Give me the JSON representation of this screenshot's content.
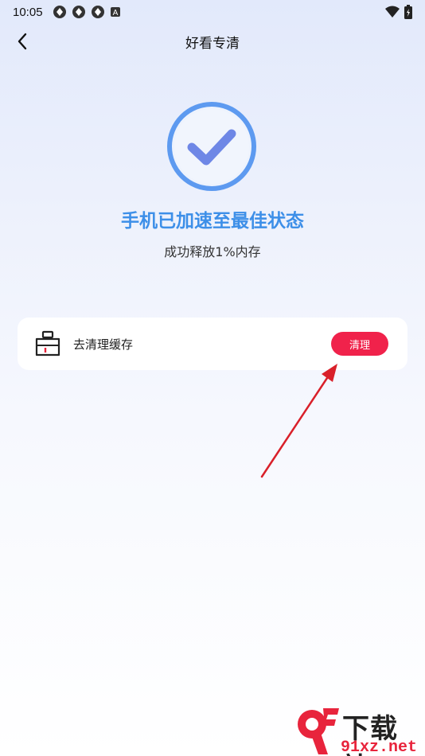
{
  "status_bar": {
    "time": "10:05",
    "notification_icons": [
      "app-icon",
      "app-icon",
      "app-icon",
      "a-icon"
    ],
    "right_icons": [
      "wifi-icon",
      "battery-icon"
    ]
  },
  "header": {
    "title": "好看专清",
    "back_icon": "chevron-left-icon"
  },
  "result": {
    "icon": "check-circle-icon",
    "headline": "手机已加速至最佳状态",
    "subline": "成功释放1%内存"
  },
  "cache_card": {
    "icon": "cleaning-bucket-icon",
    "label": "去清理缓存",
    "button_label": "清理"
  },
  "watermark": {
    "logo": "9f-logo",
    "text_main": "下载站",
    "text_url": "91xz.net"
  },
  "colors": {
    "accent_blue": "#3d8fe8",
    "button_red": "#f0224b",
    "arrow_red": "#d9202a"
  }
}
